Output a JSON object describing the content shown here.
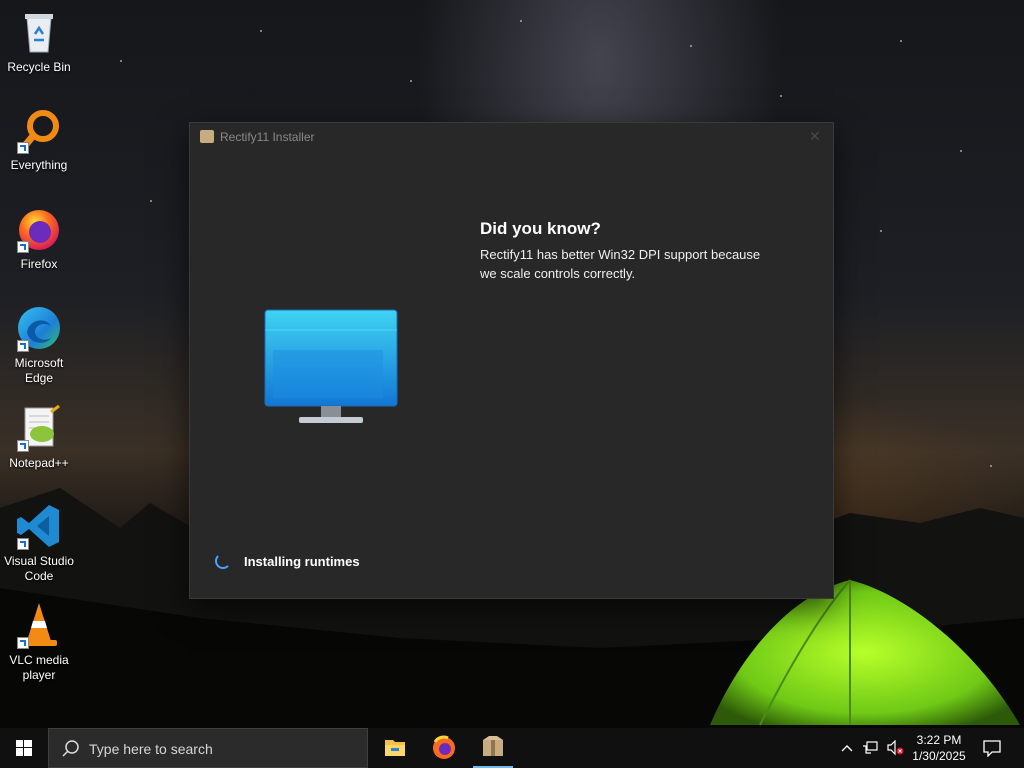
{
  "desktop": {
    "icons": [
      {
        "label": "Recycle Bin",
        "icon": "recycle-bin-icon"
      },
      {
        "label": "Everything",
        "icon": "everything-search-icon"
      },
      {
        "label": "Firefox",
        "icon": "firefox-icon"
      },
      {
        "label": "Microsoft Edge",
        "icon": "edge-icon"
      },
      {
        "label": "Notepad++",
        "icon": "notepad-plus-plus-icon"
      },
      {
        "label": "Visual Studio Code",
        "icon": "vscode-icon"
      },
      {
        "label": "VLC media player",
        "icon": "vlc-icon"
      }
    ]
  },
  "installer": {
    "title": "Rectify11 Installer",
    "tip_heading": "Did you know?",
    "tip_text": "Rectify11 has better Win32 DPI support because we scale controls correctly.",
    "status": "Installing runtimes",
    "icon": "monitor-icon",
    "accent": "#4aa3ff"
  },
  "taskbar": {
    "search_placeholder": "Type here to search",
    "apps": [
      "file-explorer-icon",
      "firefox-icon",
      "installer-icon"
    ],
    "time": "3:22 PM",
    "date": "1/30/2025"
  }
}
